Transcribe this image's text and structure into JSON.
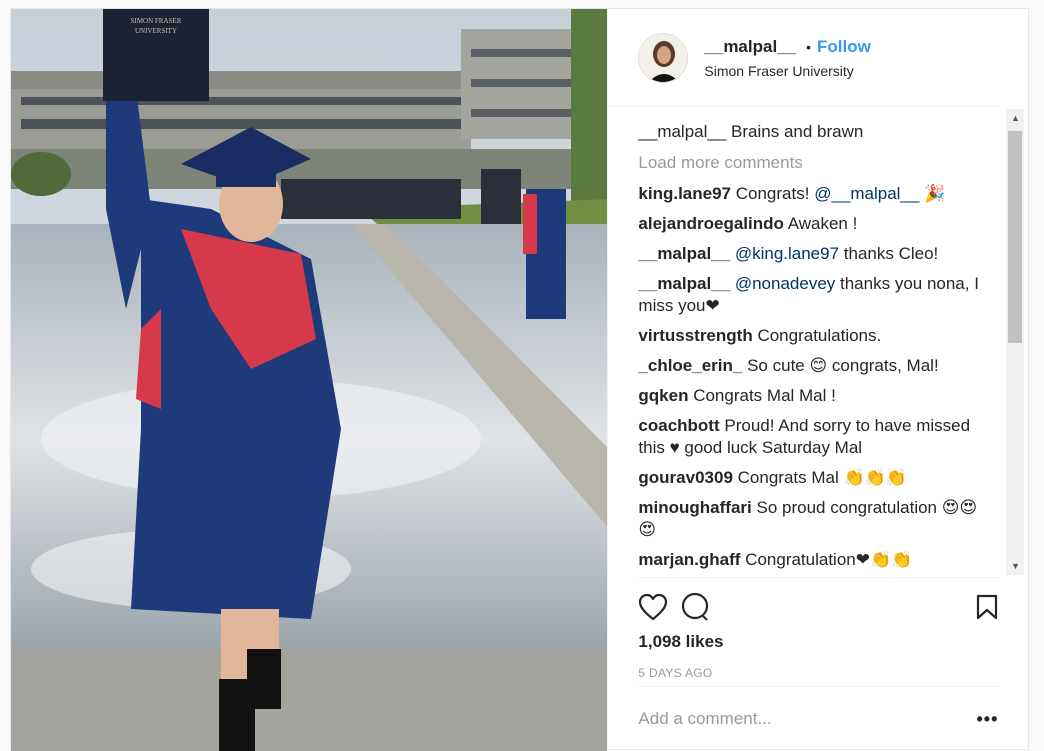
{
  "header": {
    "username": "__malpal__",
    "dot": "•",
    "follow": "Follow",
    "location": "Simon Fraser University"
  },
  "photo": {
    "book_text_line1": "SIMON FRASER",
    "book_text_line2": "UNIVERSITY"
  },
  "caption": {
    "user": "__malpal__",
    "text": "Brains and brawn"
  },
  "load_more": "Load more comments",
  "comments": [
    {
      "user": "king.lane97",
      "pre": "Congrats! ",
      "mention": "@__malpal__",
      "post": " 🎉"
    },
    {
      "user": "alejandroegalindo",
      "pre": "Awaken !",
      "mention": "",
      "post": ""
    },
    {
      "user": "__malpal__",
      "pre": "",
      "mention": "@king.lane97",
      "post": " thanks Cleo!"
    },
    {
      "user": "__malpal__",
      "pre": "",
      "mention": "@nonadevey",
      "post": " thanks you nona, I miss you❤"
    },
    {
      "user": "virtusstrength",
      "pre": "Congratulations.",
      "mention": "",
      "post": ""
    },
    {
      "user": "_chloe_erin_",
      "pre": "So cute 😊 congrats, Mal!",
      "mention": "",
      "post": ""
    },
    {
      "user": "gqken",
      "pre": "Congrats Mal Mal !",
      "mention": "",
      "post": ""
    },
    {
      "user": "coachbott",
      "pre": "Proud! And sorry to have missed this ♥ good luck Saturday Mal",
      "mention": "",
      "post": ""
    },
    {
      "user": "gourav0309",
      "pre": "Congrats Mal 👏👏👏",
      "mention": "",
      "post": ""
    },
    {
      "user": "minoughaffari",
      "pre": "So proud congratulation 😍😍😍",
      "mention": "",
      "post": ""
    },
    {
      "user": "marjan.ghaff",
      "pre": "Congratulation❤👏👏",
      "mention": "",
      "post": ""
    }
  ],
  "actions": {
    "likes": "1,098 likes",
    "date": "5 DAYS AGO"
  },
  "add_comment": {
    "placeholder": "Add a comment...",
    "more": "•••"
  },
  "icons": {
    "like": "heart-icon",
    "comment": "comment-bubble-icon",
    "save": "bookmark-icon",
    "scroll_up": "arrow-up-icon",
    "scroll_down": "arrow-down-icon"
  },
  "colors": {
    "follow": "#3897f0",
    "mention": "#003569",
    "gown": "#1f3a7a",
    "hood": "#d63a4a"
  }
}
